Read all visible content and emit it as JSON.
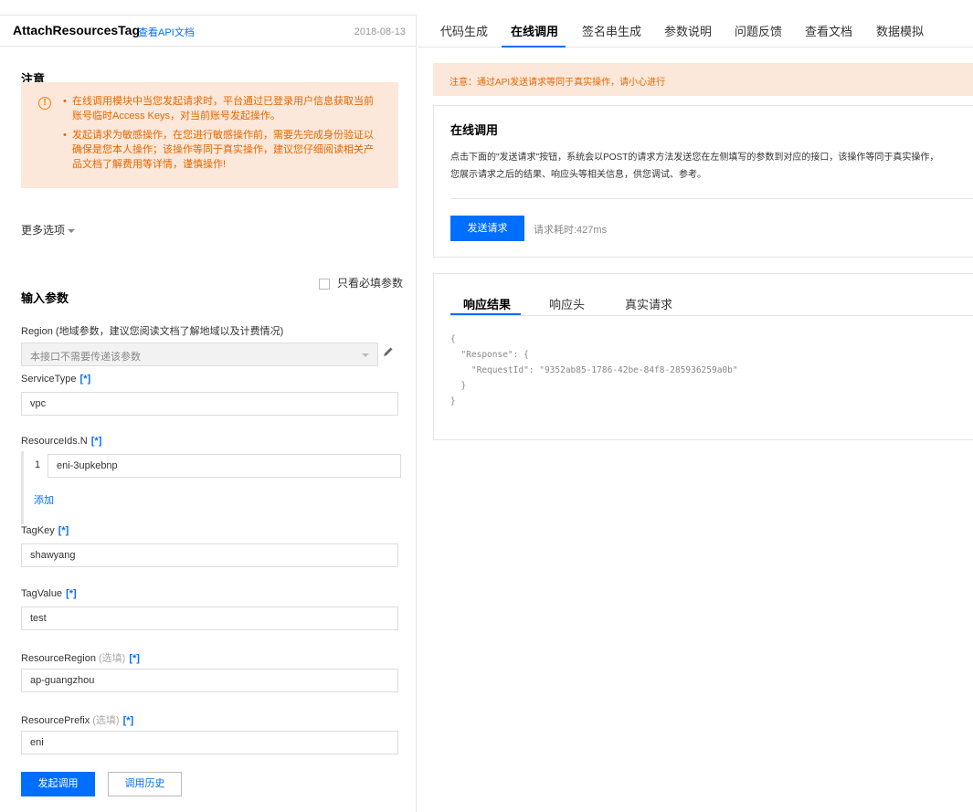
{
  "header": {
    "api_name": "AttachResourcesTag",
    "doc_link": "查看API文档",
    "date": "2018-08-13"
  },
  "notice": {
    "title": "注意",
    "items": [
      "在线调用模块中当您发起请求时，平台通过已登录用户信息获取当前账号临时Access Keys，对当前账号发起操作。",
      "发起请求为敏感操作，在您进行敏感操作前，需要先完成身份验证以确保是您本人操作；该操作等同于真实操作，建议您仔细阅读相关产品文档了解费用等详情，谨慎操作!"
    ]
  },
  "more_options": "更多选项",
  "params": {
    "title": "输入参数",
    "required_only": "只看必填参数",
    "required_mark": "[*]",
    "optional_mark": "(选填)",
    "region": {
      "label": "Region (地域参数，建议您阅读文档了解地域以及计费情况)",
      "value": "本接口不需要传递该参数"
    },
    "service_type": {
      "label": "ServiceType",
      "value": "vpc"
    },
    "resource_ids": {
      "label": "ResourceIds.N",
      "index": "1",
      "value": "eni-3upkebnp",
      "add": "添加"
    },
    "tag_key": {
      "label": "TagKey",
      "value": "shawyang"
    },
    "tag_value": {
      "label": "TagValue",
      "value": "test"
    },
    "resource_region": {
      "label": "ResourceRegion",
      "value": "ap-guangzhou"
    },
    "resource_prefix": {
      "label": "ResourcePrefix",
      "value": "eni"
    }
  },
  "actions": {
    "invoke": "发起调用",
    "history": "调用历史"
  },
  "tabs": [
    {
      "label": "代码生成",
      "active": false
    },
    {
      "label": "在线调用",
      "active": true
    },
    {
      "label": "签名串生成",
      "active": false
    },
    {
      "label": "参数说明",
      "active": false
    },
    {
      "label": "问题反馈",
      "active": false
    },
    {
      "label": "查看文档",
      "active": false
    },
    {
      "label": "数据模拟",
      "active": false
    }
  ],
  "alert": "注意：通过API发送请求等同于真实操作，请小心进行",
  "online": {
    "title": "在线调用",
    "desc_line1": "点击下面的\"发送请求\"按钮，系统会以POST的请求方法发送您在左侧填写的参数到对应的接口，该操作等同于真实操作，",
    "desc_line2": "您展示请求之后的结果、响应头等相关信息，供您调试、参考。",
    "send": "发送请求",
    "elapsed": "请求耗时:427ms"
  },
  "result": {
    "tabs": [
      "响应结果",
      "响应头",
      "真实请求"
    ],
    "code": "{\n  \"Response\": {\n    \"RequestId\": \"9352ab85-1786-42be-84f8-285936259a0b\"\n  }\n}"
  },
  "colors": {
    "accent": "#006eff",
    "warning_bg": "#fce8da",
    "warning_text": "#e56600"
  }
}
